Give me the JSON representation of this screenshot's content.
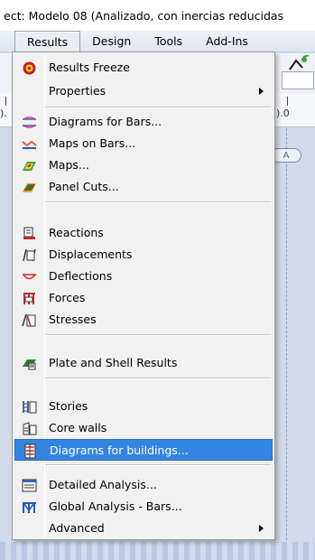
{
  "window": {
    "title": "ect: Modelo 08 (Analizado, con inercias reducidas"
  },
  "menubar": {
    "items": [
      {
        "label": "Results"
      },
      {
        "label": "Design"
      },
      {
        "label": "Tools"
      },
      {
        "label": "Add-Ins"
      }
    ]
  },
  "ruler": {
    "left_label": ").",
    "right_label": ").0"
  },
  "workspace": {
    "axis_label": "A"
  },
  "results_menu": {
    "items": [
      {
        "label": "Results Freeze",
        "icon": "freeze-icon"
      },
      {
        "label": "Properties",
        "submenu": true
      },
      {
        "label": "Diagrams for Bars...",
        "icon": "bar-diagram-icon"
      },
      {
        "label": "Maps on Bars...",
        "icon": "bar-map-icon"
      },
      {
        "label": "Maps...",
        "icon": "maps-icon"
      },
      {
        "label": "Panel Cuts...",
        "icon": "panel-cuts-icon"
      },
      {
        "label": "Reactions",
        "icon": "reactions-icon"
      },
      {
        "label": "Displacements",
        "icon": "displacements-icon"
      },
      {
        "label": "Deflections",
        "icon": "deflections-icon"
      },
      {
        "label": "Forces",
        "icon": "forces-icon"
      },
      {
        "label": "Stresses",
        "icon": "stresses-icon"
      },
      {
        "label": "Plate and Shell Results",
        "icon": "plate-shell-icon"
      },
      {
        "label": "Stories",
        "icon": "stories-icon"
      },
      {
        "label": "Core walls",
        "icon": "core-walls-icon"
      },
      {
        "label": "Diagrams for buildings...",
        "icon": "building-diagram-icon",
        "highlighted": true
      },
      {
        "label": "Detailed Analysis...",
        "icon": "detailed-analysis-icon"
      },
      {
        "label": "Global Analysis - Bars...",
        "icon": "global-analysis-icon"
      },
      {
        "label": "Advanced",
        "submenu": true
      }
    ]
  },
  "colors": {
    "highlight": "#3385e0",
    "menu_bg": "#f1f1f1"
  }
}
